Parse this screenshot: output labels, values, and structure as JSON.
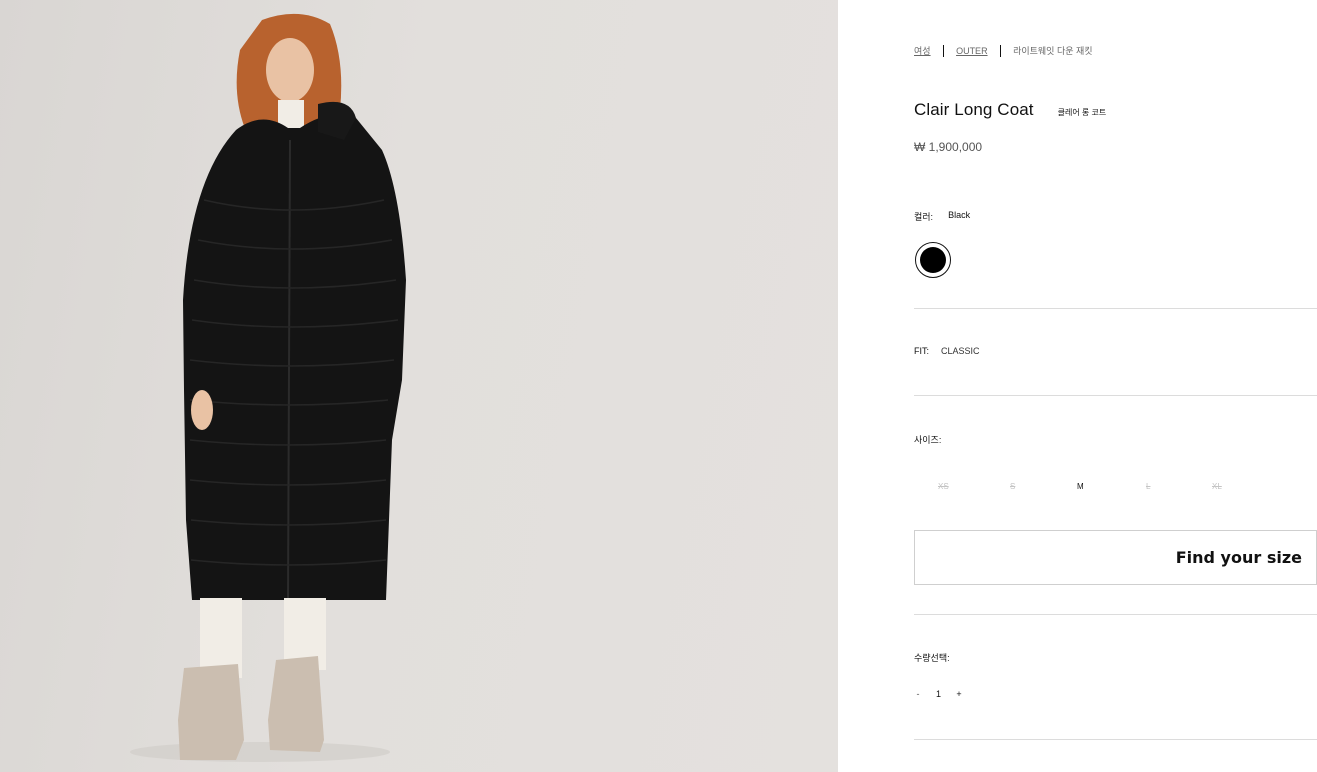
{
  "breadcrumb": {
    "items": [
      "여성",
      "OUTER",
      "라이트웨잇 다운 재킷"
    ]
  },
  "product": {
    "title": "Clair Long Coat",
    "subtitle": "클레어 롱 코트",
    "price": "₩ 1,900,000"
  },
  "color": {
    "label": "컬러:",
    "selected": "Black",
    "swatch_hex": "#000000"
  },
  "fit": {
    "label": "FIT:",
    "value": "CLASSIC"
  },
  "size": {
    "label": "사이즈:",
    "options": [
      {
        "label": "XS",
        "available": false
      },
      {
        "label": "S",
        "available": false
      },
      {
        "label": "M",
        "available": true
      },
      {
        "label": "L",
        "available": false
      },
      {
        "label": "XL",
        "available": false
      }
    ],
    "find_your_size": "Find your size"
  },
  "quantity": {
    "label": "수량선택:",
    "minus": "-",
    "value": "1",
    "plus": "+"
  },
  "colors": {
    "background_photo": "#e0dddb",
    "coat": "#141414",
    "divider": "#dcdcdc"
  }
}
